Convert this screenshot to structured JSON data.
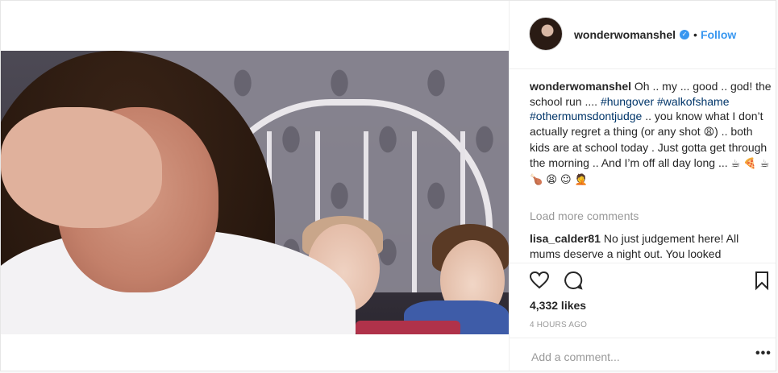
{
  "post": {
    "header": {
      "username": "wonderwomanshel",
      "separator": "•",
      "follow_label": "Follow"
    },
    "caption": {
      "username": "wonderwomanshel",
      "text_1": "Oh .. my ... good .. god! the school run ....",
      "tag_1": "#hungover",
      "tag_2": "#walkofshame",
      "tag_3": "#othermumsdontjudge",
      "text_2": ".. you know what I don’t actually regret a thing (or any shot",
      "emoji_1": "😩",
      "text_3": ") .. both kids are at school today . Just gotta get through the morning .. And I’m off all day long ...",
      "emoji_2": "☕ 🍕 ☕ 🍗 😫 ☺ 🤦"
    },
    "load_more_label": "Load more comments",
    "comment": {
      "username": "lisa_calder81",
      "text": "No just judgement here! All mums deserve a night out. You looked"
    },
    "actions": {
      "like_icon": "heart-icon",
      "comment_icon": "comment-icon",
      "save_icon": "bookmark-icon"
    },
    "likes": "4,332 likes",
    "timestamp": "4 HOURS AGO",
    "add_comment_placeholder": "Add a comment...",
    "more_label": "•••"
  },
  "colors": {
    "link_blue": "#3897f0",
    "hashtag": "#003569",
    "muted": "#999999",
    "text": "#262626"
  }
}
